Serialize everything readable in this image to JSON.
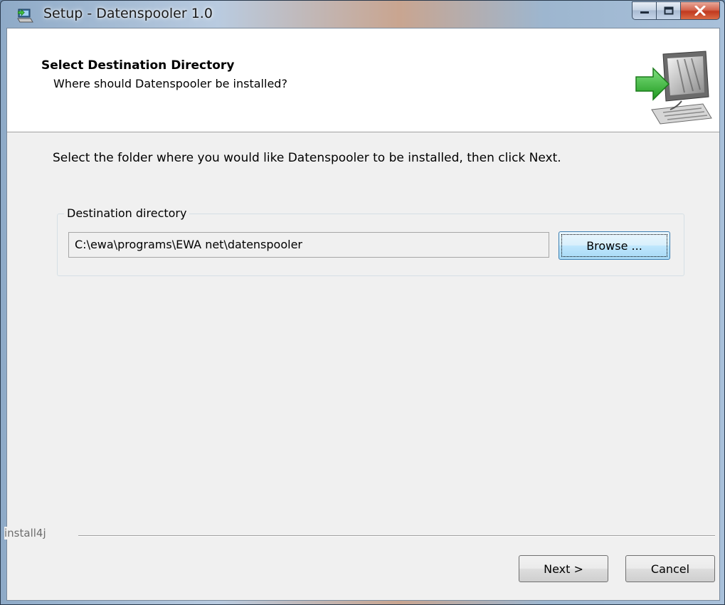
{
  "window": {
    "title": "Setup - Datenspooler 1.0",
    "icons": {
      "app": "setup-computer-icon",
      "minimize": "minimize-icon",
      "maximize": "maximize-icon",
      "close": "close-icon"
    }
  },
  "header": {
    "title": "Select Destination Directory",
    "subtitle": "Where should Datenspooler be installed?",
    "graphic": "install-arrow-computer-icon"
  },
  "main": {
    "instructions": "Select the folder where you would like Datenspooler to be installed, then click Next.",
    "group_label": "Destination directory",
    "path_value": "C:\\ewa\\programs\\EWA net\\datenspooler",
    "browse_label": "Browse ..."
  },
  "footer": {
    "brand": "install4j",
    "next_label": "Next >",
    "cancel_label": "Cancel"
  },
  "colors": {
    "client_bg": "#f0f0f0",
    "header_bg": "#ffffff",
    "close_red": "#c1391f",
    "focus_blue": "#3c7fb1",
    "arrow_green": "#3fbf3f"
  }
}
